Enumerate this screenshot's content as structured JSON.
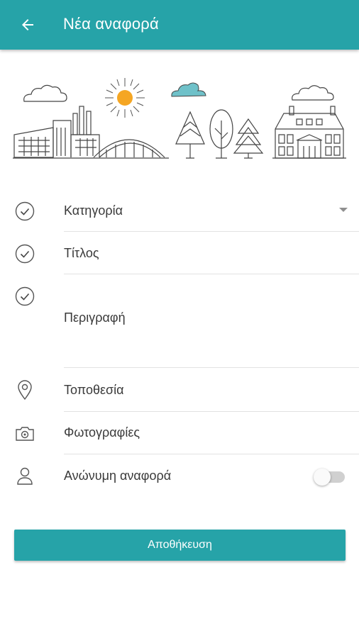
{
  "appbar": {
    "title": "Νέα αναφορά",
    "back_icon": "arrow-left-icon",
    "background": "#26a3a8"
  },
  "form": {
    "category": {
      "label": "Κατηγορία",
      "icon": "check-circle-icon"
    },
    "title": {
      "label": "Τίτλος",
      "icon": "check-circle-icon"
    },
    "description": {
      "label": "Περιγραφή",
      "icon": "check-circle-icon"
    },
    "location": {
      "label": "Τοποθεσία",
      "icon": "location-pin-icon"
    },
    "photos": {
      "label": "Φωτογραφίες",
      "icon": "camera-icon"
    },
    "anonymous": {
      "label": "Ανώνυμη αναφορά",
      "icon": "person-icon",
      "enabled": false
    }
  },
  "save": {
    "label": "Αποθήκευση"
  },
  "colors": {
    "accent": "#26a3a8",
    "sun": "#f5a623",
    "cloud_fill": "#6fc1c9"
  }
}
